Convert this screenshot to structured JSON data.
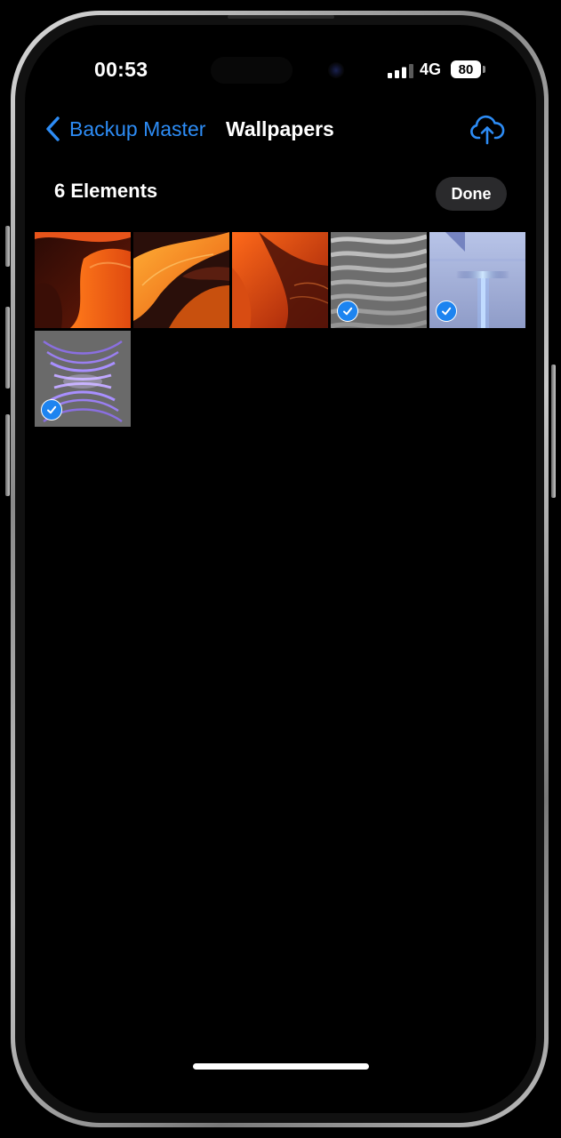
{
  "status_bar": {
    "time": "00:53",
    "network": "4G",
    "battery": "80",
    "signal_bars": 4,
    "signal_active": 3
  },
  "nav": {
    "back_label": "Backup Master",
    "title": "Wallpapers",
    "back_icon": "chevron-left-icon",
    "action_icon": "cloud-upload-icon",
    "accent_color": "#2d8cf5"
  },
  "toolbar": {
    "count_label": "6 Elements",
    "done_label": "Done"
  },
  "photos": [
    {
      "name": "red-desert-dunes-1",
      "selected": false
    },
    {
      "name": "orange-desert-dunes",
      "selected": false
    },
    {
      "name": "red-desert-dunes-2",
      "selected": false
    },
    {
      "name": "gray-sand-ripples",
      "selected": true
    },
    {
      "name": "blue-light-cross",
      "selected": true
    },
    {
      "name": "purple-light-waves",
      "selected": true
    }
  ]
}
